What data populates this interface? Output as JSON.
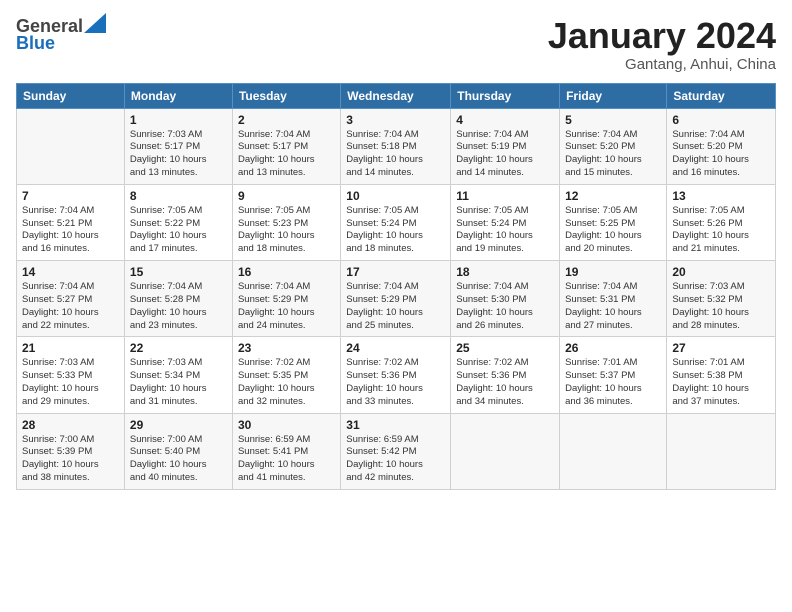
{
  "header": {
    "logo_general": "General",
    "logo_blue": "Blue",
    "month_title": "January 2024",
    "subtitle": "Gantang, Anhui, China"
  },
  "days_of_week": [
    "Sunday",
    "Monday",
    "Tuesday",
    "Wednesday",
    "Thursday",
    "Friday",
    "Saturday"
  ],
  "weeks": [
    [
      {
        "num": "",
        "info": ""
      },
      {
        "num": "1",
        "info": "Sunrise: 7:03 AM\nSunset: 5:17 PM\nDaylight: 10 hours\nand 13 minutes."
      },
      {
        "num": "2",
        "info": "Sunrise: 7:04 AM\nSunset: 5:17 PM\nDaylight: 10 hours\nand 13 minutes."
      },
      {
        "num": "3",
        "info": "Sunrise: 7:04 AM\nSunset: 5:18 PM\nDaylight: 10 hours\nand 14 minutes."
      },
      {
        "num": "4",
        "info": "Sunrise: 7:04 AM\nSunset: 5:19 PM\nDaylight: 10 hours\nand 14 minutes."
      },
      {
        "num": "5",
        "info": "Sunrise: 7:04 AM\nSunset: 5:20 PM\nDaylight: 10 hours\nand 15 minutes."
      },
      {
        "num": "6",
        "info": "Sunrise: 7:04 AM\nSunset: 5:20 PM\nDaylight: 10 hours\nand 16 minutes."
      }
    ],
    [
      {
        "num": "7",
        "info": "Sunrise: 7:04 AM\nSunset: 5:21 PM\nDaylight: 10 hours\nand 16 minutes."
      },
      {
        "num": "8",
        "info": "Sunrise: 7:05 AM\nSunset: 5:22 PM\nDaylight: 10 hours\nand 17 minutes."
      },
      {
        "num": "9",
        "info": "Sunrise: 7:05 AM\nSunset: 5:23 PM\nDaylight: 10 hours\nand 18 minutes."
      },
      {
        "num": "10",
        "info": "Sunrise: 7:05 AM\nSunset: 5:24 PM\nDaylight: 10 hours\nand 18 minutes."
      },
      {
        "num": "11",
        "info": "Sunrise: 7:05 AM\nSunset: 5:24 PM\nDaylight: 10 hours\nand 19 minutes."
      },
      {
        "num": "12",
        "info": "Sunrise: 7:05 AM\nSunset: 5:25 PM\nDaylight: 10 hours\nand 20 minutes."
      },
      {
        "num": "13",
        "info": "Sunrise: 7:05 AM\nSunset: 5:26 PM\nDaylight: 10 hours\nand 21 minutes."
      }
    ],
    [
      {
        "num": "14",
        "info": "Sunrise: 7:04 AM\nSunset: 5:27 PM\nDaylight: 10 hours\nand 22 minutes."
      },
      {
        "num": "15",
        "info": "Sunrise: 7:04 AM\nSunset: 5:28 PM\nDaylight: 10 hours\nand 23 minutes."
      },
      {
        "num": "16",
        "info": "Sunrise: 7:04 AM\nSunset: 5:29 PM\nDaylight: 10 hours\nand 24 minutes."
      },
      {
        "num": "17",
        "info": "Sunrise: 7:04 AM\nSunset: 5:29 PM\nDaylight: 10 hours\nand 25 minutes."
      },
      {
        "num": "18",
        "info": "Sunrise: 7:04 AM\nSunset: 5:30 PM\nDaylight: 10 hours\nand 26 minutes."
      },
      {
        "num": "19",
        "info": "Sunrise: 7:04 AM\nSunset: 5:31 PM\nDaylight: 10 hours\nand 27 minutes."
      },
      {
        "num": "20",
        "info": "Sunrise: 7:03 AM\nSunset: 5:32 PM\nDaylight: 10 hours\nand 28 minutes."
      }
    ],
    [
      {
        "num": "21",
        "info": "Sunrise: 7:03 AM\nSunset: 5:33 PM\nDaylight: 10 hours\nand 29 minutes."
      },
      {
        "num": "22",
        "info": "Sunrise: 7:03 AM\nSunset: 5:34 PM\nDaylight: 10 hours\nand 31 minutes."
      },
      {
        "num": "23",
        "info": "Sunrise: 7:02 AM\nSunset: 5:35 PM\nDaylight: 10 hours\nand 32 minutes."
      },
      {
        "num": "24",
        "info": "Sunrise: 7:02 AM\nSunset: 5:36 PM\nDaylight: 10 hours\nand 33 minutes."
      },
      {
        "num": "25",
        "info": "Sunrise: 7:02 AM\nSunset: 5:36 PM\nDaylight: 10 hours\nand 34 minutes."
      },
      {
        "num": "26",
        "info": "Sunrise: 7:01 AM\nSunset: 5:37 PM\nDaylight: 10 hours\nand 36 minutes."
      },
      {
        "num": "27",
        "info": "Sunrise: 7:01 AM\nSunset: 5:38 PM\nDaylight: 10 hours\nand 37 minutes."
      }
    ],
    [
      {
        "num": "28",
        "info": "Sunrise: 7:00 AM\nSunset: 5:39 PM\nDaylight: 10 hours\nand 38 minutes."
      },
      {
        "num": "29",
        "info": "Sunrise: 7:00 AM\nSunset: 5:40 PM\nDaylight: 10 hours\nand 40 minutes."
      },
      {
        "num": "30",
        "info": "Sunrise: 6:59 AM\nSunset: 5:41 PM\nDaylight: 10 hours\nand 41 minutes."
      },
      {
        "num": "31",
        "info": "Sunrise: 6:59 AM\nSunset: 5:42 PM\nDaylight: 10 hours\nand 42 minutes."
      },
      {
        "num": "",
        "info": ""
      },
      {
        "num": "",
        "info": ""
      },
      {
        "num": "",
        "info": ""
      }
    ]
  ]
}
